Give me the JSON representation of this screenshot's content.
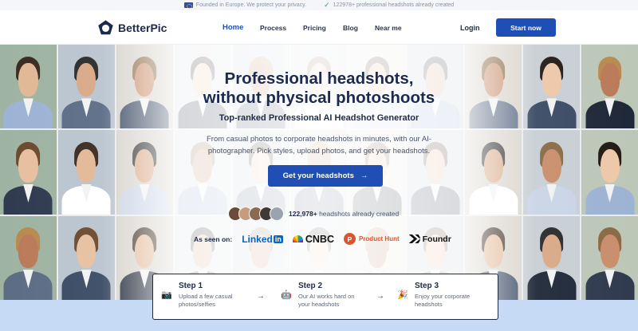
{
  "banner": {
    "privacy_text": "Founded in Europe. We protect your privacy.",
    "count_text": "122978+ professional headshots already created"
  },
  "nav": {
    "brand": "BetterPic",
    "links": [
      "Home",
      "Process",
      "Pricing",
      "Blog",
      "Near me"
    ],
    "active": "Home",
    "login": "Login",
    "start": "Start now"
  },
  "hero": {
    "title_line1": "Professional headshots,",
    "title_line2": "without physical photoshoots",
    "subtitle": "Top-ranked Professional AI Headshot Generator",
    "desc_line1": "From casual photos to corporate headshots in minutes, with our AI-",
    "desc_line2": "photographer. Pick styles, upload photos, and get your headshots.",
    "cta": "Get your headshots",
    "cta_arrow": "→",
    "social_count": "122,978+",
    "social_text": "headshots already created",
    "seen_on": "As seen on:",
    "press": {
      "linkedin_a": "Linked",
      "linkedin_b": "in",
      "cnbc": "CNBC",
      "producthunt_mark": "P",
      "producthunt": "Product Hunt",
      "foundr": "Foundr"
    }
  },
  "steps": [
    {
      "title": "Step 1",
      "line1": "Upload a few casual",
      "line2": "photos/selfies",
      "icon": "📷"
    },
    {
      "title": "Step 2",
      "line1": "Our AI works hard on",
      "line2": "your headshots",
      "icon": "🤖"
    },
    {
      "title": "Step 3",
      "line1": "Enjoy your corporate",
      "line2": "headshots",
      "icon": "🎉"
    }
  ],
  "colors": {
    "accent": "#1f4fb5",
    "navy": "#1b2a4e",
    "bottom_band": "#c7daf5"
  }
}
